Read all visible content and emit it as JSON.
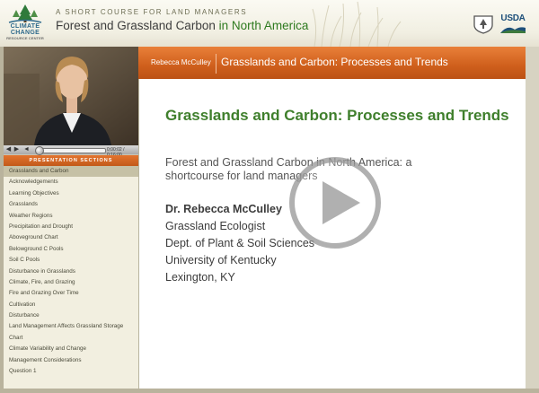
{
  "header": {
    "logo": {
      "line1": "CLIMATE",
      "line2": "CHANGE",
      "line3": "RESOURCE CENTER"
    },
    "tagline": "A SHORT COURSE FOR LAND MANAGERS",
    "title_main": "Forest and Grassland Carbon",
    "title_highlight": "in North America",
    "usda_label": "USDA"
  },
  "player": {
    "timecode": "0:00:02 / 0:16:00",
    "progress": 0.0
  },
  "sidebar": {
    "header": "PRESENTATION SECTIONS",
    "active_index": 0,
    "items": [
      "Grasslands and Carbon",
      "Acknowledgements",
      "Learning Objectives",
      "Grasslands",
      "Weather Regions",
      "Precipitation and Drought",
      "Aboveground Chart",
      "Belowground C Pools",
      "Soil C Pools",
      "Disturbance in Grasslands",
      "Climate, Fire, and Grazing",
      "Fire and Grazing Over Time",
      "Cultivation",
      "Disturbance",
      "Land Management Affects Grassland Storage",
      "Chart",
      "Climate Variability and Change",
      "Management Considerations",
      "Question 1"
    ]
  },
  "slide_bar": {
    "presenter": "Rebecca McCulley",
    "title": "Grasslands and Carbon: Processes and Trends"
  },
  "slide": {
    "title": "Grasslands and Carbon: Processes and Trends",
    "subtitle": "Forest and Grassland Carbon in North America: a shortcourse for land managers",
    "speaker_name": "Dr. Rebecca McCulley",
    "speaker_lines": [
      "Grassland Ecologist",
      "Dept. of Plant & Soil Sciences",
      "University of Kentucky",
      "Lexington, KY"
    ]
  },
  "colors": {
    "accent_orange": "#d9671f",
    "title_green": "#3f7f2c"
  }
}
